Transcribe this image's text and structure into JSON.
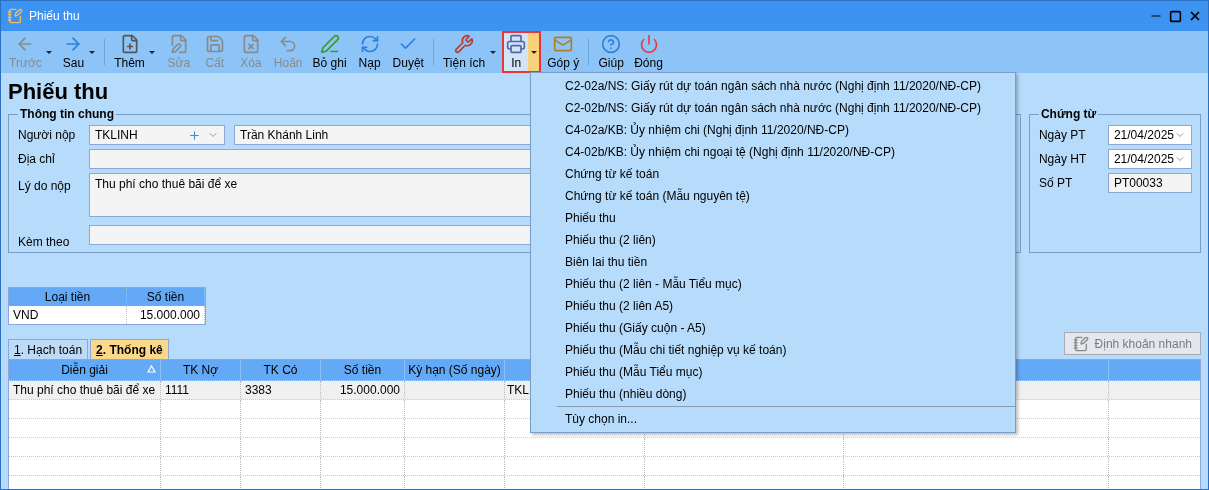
{
  "window": {
    "title": "Phiếu thu"
  },
  "toolbar": [
    [
      {
        "label": "Trước",
        "disabled": true,
        "has_menu": true,
        "selected": false
      },
      {
        "label": "Sau",
        "disabled": false,
        "has_menu": true,
        "selected": false
      }
    ],
    [
      {
        "label": "Thêm",
        "disabled": false,
        "has_menu": true,
        "selected": false
      },
      {
        "label": "Sửa",
        "disabled": true,
        "has_menu": false,
        "selected": false
      },
      {
        "label": "Cất",
        "disabled": true,
        "has_menu": false,
        "selected": false
      },
      {
        "label": "Xóa",
        "disabled": true,
        "has_menu": false,
        "selected": false
      },
      {
        "label": "Hoãn",
        "disabled": true,
        "has_menu": false,
        "selected": false
      },
      {
        "label": "Bỏ ghi",
        "disabled": false,
        "has_menu": false,
        "selected": false
      },
      {
        "label": "Nạp",
        "disabled": false,
        "has_menu": false,
        "selected": false
      },
      {
        "label": "Duyệt",
        "disabled": false,
        "has_menu": false,
        "selected": false
      }
    ],
    [
      {
        "label": "Tiện ích",
        "disabled": false,
        "has_menu": true,
        "selected": false
      },
      {
        "label": "In",
        "disabled": false,
        "has_menu": true,
        "selected": true
      },
      {
        "label": "Góp ý",
        "disabled": false,
        "has_menu": false,
        "selected": false
      }
    ],
    [
      {
        "label": "Giúp",
        "disabled": false,
        "has_menu": false,
        "selected": false
      },
      {
        "label": "Đóng",
        "disabled": false,
        "has_menu": false,
        "selected": false
      }
    ]
  ],
  "heading": "Phiếu thu",
  "general_info": {
    "title": "Thông tin chung",
    "payer_label": "Người nộp",
    "payer_code": "TKLINH",
    "payer_name": "Trần Khánh Linh",
    "address_label": "Địa chỉ",
    "reason_label": "Lý do nộp",
    "reason": "Thu phí cho thuê bãi để xe",
    "attached_label": "Kèm theo"
  },
  "voucher": {
    "title": "Chứng từ",
    "fields": [
      {
        "label": "Ngày PT",
        "value": "21/04/2025",
        "kind": "date"
      },
      {
        "label": "Ngày HT",
        "value": "21/04/2025",
        "kind": "date"
      },
      {
        "label": "Số PT",
        "value": "PT00033",
        "kind": "text"
      }
    ]
  },
  "currency_table": {
    "columns": [
      "Loại tiền",
      "Số tiền"
    ],
    "rows": [
      [
        "VND",
        "15.000.000"
      ]
    ]
  },
  "tabs": [
    {
      "key": "1",
      "rest": ". Hạch toán",
      "selected": false
    },
    {
      "key": "2",
      "rest": ". Thống kê",
      "selected": true
    }
  ],
  "quick_entry_button": {
    "label": "Định khoản nhanh",
    "disabled": true
  },
  "grid": {
    "columns": [
      {
        "label": "Diễn giải",
        "sorted": true
      },
      {
        "label": "TK Nợ",
        "sorted": false
      },
      {
        "label": "TK Có",
        "sorted": false
      },
      {
        "label": "Số tiền",
        "sorted": false
      },
      {
        "label": "Kỳ hạn (Số ngày)",
        "sorted": false
      }
    ],
    "rows": [
      {
        "cells": [
          "Thu phí cho thuê bãi để xe",
          "1111",
          "3383",
          "15.000.000"
        ],
        "column_6": "TKL"
      }
    ]
  },
  "print_menu": {
    "items": [
      "C2-02a/NS: Giấy rút dự toán ngân sách nhà nước (Nghị định 11/2020/NĐ-CP)",
      "C2-02b/NS: Giấy rút dự toán ngân sách nhà nước (Nghị định 11/2020/NĐ-CP)",
      "C4-02a/KB: Ủy nhiệm chi (Nghị định 11/2020/NĐ-CP)",
      "C4-02b/KB: Ủy nhiệm chi ngoại tệ (Nghị định 11/2020/NĐ-CP)",
      "Chứng từ kế toán",
      "Chứng từ kế toán (Mẫu nguyên tệ)",
      "Phiếu thu",
      "Phiếu thu (2 liên)",
      "Biên lai thu tiền",
      "Phiếu thu (2 liên - Mẫu Tiểu mục)",
      "Phiếu thu (2 liên A5)",
      "Phiếu thu (Giấy cuộn - A5)",
      "Phiếu thu (Mẫu chi tiết nghiệp vụ kế toán)",
      "Phiếu thu (Mẫu Tiểu mục)",
      "Phiếu thu (nhiều dòng)"
    ],
    "footer_items": [
      "Tùy chọn in..."
    ]
  }
}
